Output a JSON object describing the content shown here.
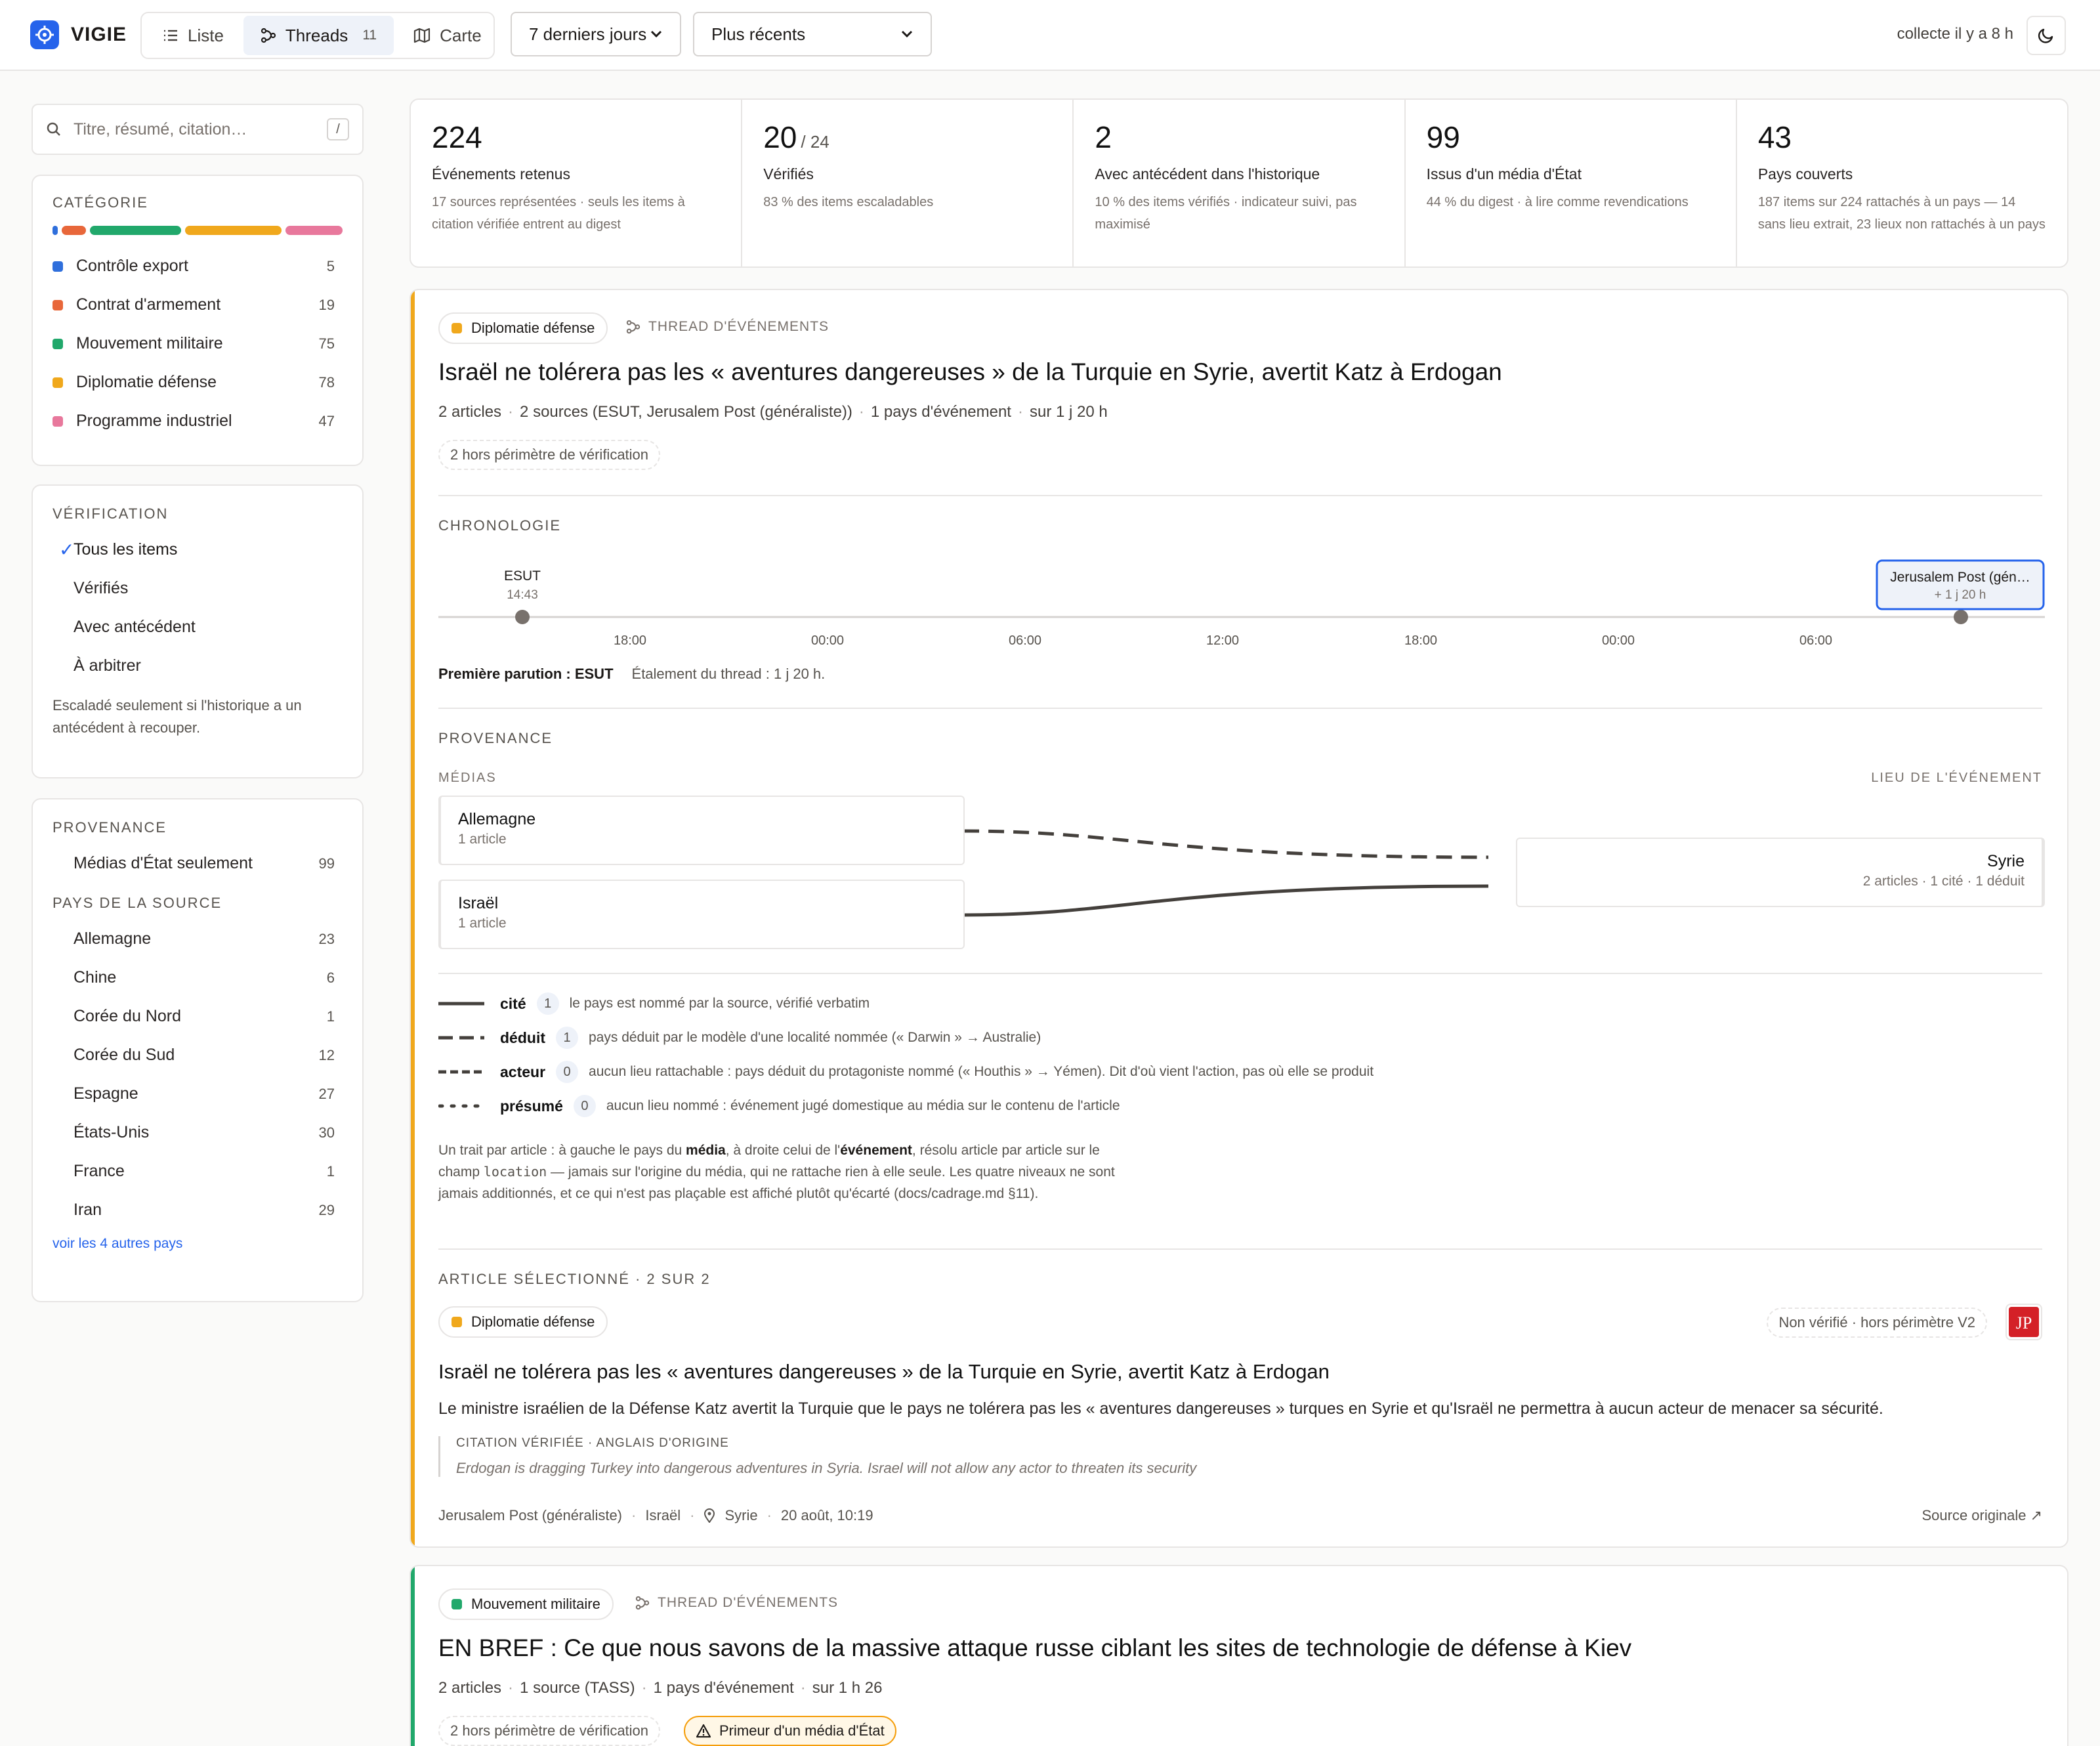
{
  "app": {
    "name": "VIGIE",
    "collect_status": "collecte il y a 8 h"
  },
  "views": [
    {
      "label": "Liste",
      "icon": "list-icon"
    },
    {
      "label": "Threads",
      "icon": "threads-icon",
      "count": "11",
      "active": true
    },
    {
      "label": "Carte",
      "icon": "map-icon"
    }
  ],
  "filters": {
    "period": "7 derniers jours",
    "sort": "Plus récents"
  },
  "search": {
    "placeholder": "Titre, résumé, citation…",
    "shortcut": "/"
  },
  "category_panel": {
    "title": "CATÉGORIE",
    "items": [
      {
        "label": "Contrôle export",
        "count": "5",
        "color": "#2f6fdc"
      },
      {
        "label": "Contrat d'armement",
        "count": "19",
        "color": "#e8673a"
      },
      {
        "label": "Mouvement militaire",
        "count": "75",
        "color": "#21a86b"
      },
      {
        "label": "Diplomatie défense",
        "count": "78",
        "color": "#f0a81c"
      },
      {
        "label": "Programme industriel",
        "count": "47",
        "color": "#e8789c"
      }
    ]
  },
  "verification_panel": {
    "title": "VÉRIFICATION",
    "items": [
      "Tous les items",
      "Vérifiés",
      "Avec antécédent",
      "À arbitrer"
    ],
    "note": "Escaladé seulement si l'historique a un antécédent à recouper."
  },
  "provenance_panel": {
    "title": "PROVENANCE",
    "state_only": {
      "label": "Médias d'État seulement",
      "count": "99"
    },
    "country_title": "PAYS DE LA SOURCE",
    "countries": [
      {
        "label": "Allemagne",
        "count": "23"
      },
      {
        "label": "Chine",
        "count": "6"
      },
      {
        "label": "Corée du Nord",
        "count": "1"
      },
      {
        "label": "Corée du Sud",
        "count": "12"
      },
      {
        "label": "Espagne",
        "count": "27"
      },
      {
        "label": "États-Unis",
        "count": "30"
      },
      {
        "label": "France",
        "count": "1"
      },
      {
        "label": "Iran",
        "count": "29"
      }
    ],
    "more_link": "voir les 4 autres pays"
  },
  "stats": [
    {
      "value": "224",
      "suffix": "",
      "label": "Événements retenus",
      "note": "17 sources représentées · seuls les items à citation vérifiée entrent au digest"
    },
    {
      "value": "20",
      "suffix": "/ 24",
      "label": "Vérifiés",
      "note": "83 % des items escaladables"
    },
    {
      "value": "2",
      "suffix": "",
      "label": "Avec antécédent dans l'historique",
      "note": "10 % des items vérifiés · indicateur suivi, pas maximisé"
    },
    {
      "value": "99",
      "suffix": "",
      "label": "Issus d'un média d'État",
      "note": "44 % du digest · à lire comme revendications"
    },
    {
      "value": "43",
      "suffix": "",
      "label": "Pays couverts",
      "note": "187 items sur 224 rattachés à un pays — 14 sans lieu extrait, 23 lieux non rattachés à un pays"
    }
  ],
  "thread1": {
    "category": "Diplomatie défense",
    "category_color": "#f0a81c",
    "eyebrow": "THREAD D'ÉVÉNEMENTS",
    "title": "Israël ne tolérera pas les « aventures dangereuses » de la Turquie en Syrie, avertit Katz à Erdogan",
    "meta": [
      "2 articles",
      "2 sources (ESUT, Jerusalem Post (généraliste))",
      "1 pays d'événement",
      "sur 1 j 20 h"
    ],
    "scope_chip": "2 hors périmètre de vérification",
    "chronology": {
      "title": "CHRONOLOGIE",
      "events": [
        {
          "source": "ESUT",
          "time": "14:43"
        },
        {
          "source": "Jerusalem Post (gén…",
          "time": "+ 1 j 20 h"
        }
      ],
      "ticks": [
        "18:00",
        "00:00",
        "06:00",
        "12:00",
        "18:00",
        "00:00",
        "06:00"
      ],
      "first": "Première parution : ESUT",
      "spread": "Étalement du thread : 1 j 20 h."
    },
    "provenance": {
      "title": "PROVENANCE",
      "left_label": "MÉDIAS",
      "right_label": "LIEU DE L'ÉVÉNEMENT",
      "media": [
        {
          "name": "Allemagne",
          "sub": "1 article"
        },
        {
          "name": "Israël",
          "sub": "1 article"
        }
      ],
      "target": {
        "name": "Syrie",
        "sub": "2 articles · 1 cité · 1 déduit"
      }
    },
    "legend": [
      {
        "name": "cité",
        "count": "1",
        "desc": "le pays est nommé par la source, vérifié verbatim"
      },
      {
        "name": "déduit",
        "count": "1",
        "desc": "pays déduit par le modèle d'une localité nommée (« Darwin » → Australie)"
      },
      {
        "name": "acteur",
        "count": "0",
        "desc": "aucun lieu rattachable : pays déduit du protagoniste nommé (« Houthis » → Yémen). Dit d'où vient l'action, pas où elle se produit"
      },
      {
        "name": "présumé",
        "count": "0",
        "desc": "aucun lieu nommé : événement jugé domestique au média sur le contenu de l'article"
      }
    ],
    "explain": {
      "p1": "Un trait par article : à gauche le pays du ",
      "b1": "média",
      "p2": ", à droite celui de l'",
      "b2": "événement",
      "p3": ", résolu article par article sur le champ ",
      "code": "location",
      "p4": " — jamais sur l'origine du média, qui ne rattache rien à elle seule. Les quatre niveaux ne sont jamais additionnés, et ce qui n'est pas plaçable est affiché plutôt qu'écarté (docs/cadrage.md §11)."
    },
    "article": {
      "section": "ARTICLE SÉLECTIONNÉ · 2 SUR 2",
      "category": "Diplomatie défense",
      "status": "Non vérifié · hors périmètre V2",
      "logo": "JP",
      "title": "Israël ne tolérera pas les « aventures dangereuses » de la Turquie en Syrie, avertit Katz à Erdogan",
      "summary": "Le ministre israélien de la Défense Katz avertit la Turquie que le pays ne tolérera pas les « aventures dangereuses » turques en Syrie et qu'Israël ne permettra à aucun acteur de menacer sa sécurité.",
      "quote_header": "CITATION VÉRIFIÉE · ANGLAIS D'ORIGINE",
      "quote": "Erdogan is dragging Turkey into dangerous adventures in Syria. Israel will not allow any actor to threaten its security",
      "source": "Jerusalem Post (généraliste)",
      "country": "Israël",
      "location": "Syrie",
      "date": "20 août, 10:19",
      "link": "Source originale ↗"
    }
  },
  "thread2": {
    "category": "Mouvement militaire",
    "category_color": "#21a86b",
    "eyebrow": "THREAD D'ÉVÉNEMENTS",
    "title": "EN BREF : Ce que nous savons de la massive attaque russe ciblant les sites de technologie de défense à Kiev",
    "meta": [
      "2 articles",
      "1 source (TASS)",
      "1 pays d'événement",
      "sur 1 h 26"
    ],
    "scope_chip": "2 hors périmètre de vérification",
    "state_chip": "Primeur d'un média d'État"
  }
}
